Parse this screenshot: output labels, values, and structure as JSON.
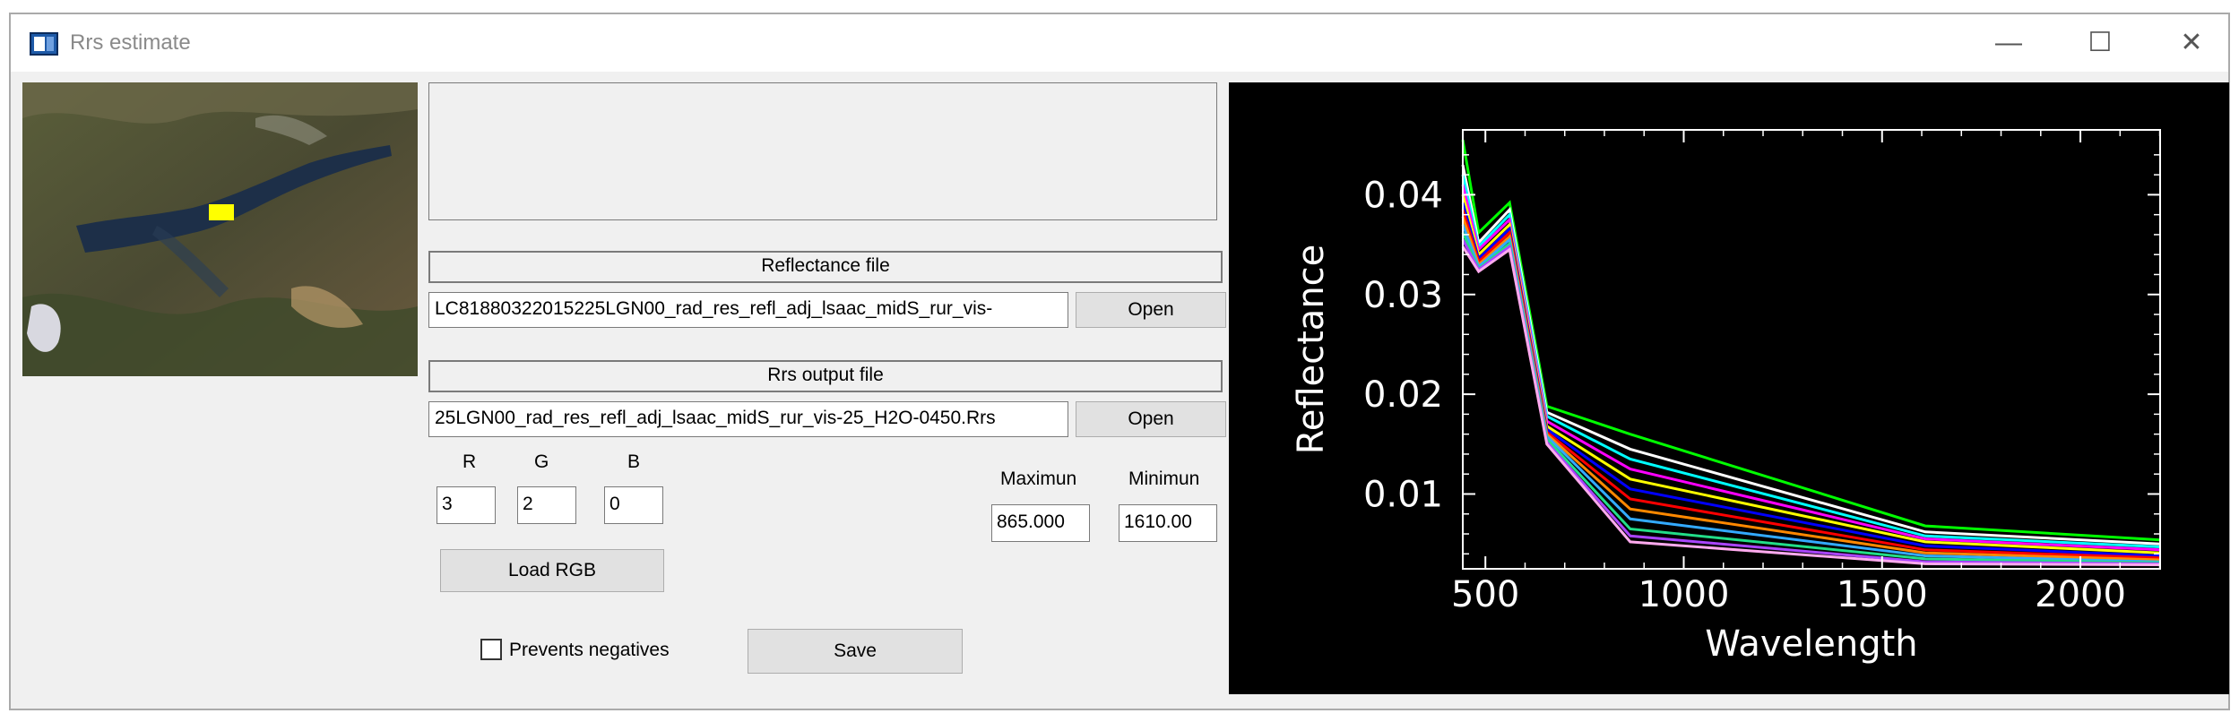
{
  "window": {
    "title": "Rrs estimate",
    "controls": {
      "minimize": "—",
      "maximize": "☐",
      "close": "✕"
    }
  },
  "reflectance": {
    "header": "Reflectance file",
    "path": "LC81880322015225LGN00_rad_res_refl_adj_lsaac_midS_rur_vis-",
    "open_label": "Open"
  },
  "rrs_output": {
    "header": "Rrs output file",
    "path": "25LGN00_rad_res_refl_adj_lsaac_midS_rur_vis-25_H2O-0450.Rrs",
    "open_label": "Open"
  },
  "rgb": {
    "r_label": "R",
    "g_label": "G",
    "b_label": "B",
    "r_value": "3",
    "g_value": "2",
    "b_value": "0",
    "load_label": "Load RGB"
  },
  "range": {
    "max_label": "Maximun",
    "min_label": "Minimun",
    "max_value": "865.000",
    "min_value": "1610.00"
  },
  "options": {
    "prevent_negatives_label": "Prevents negatives",
    "prevent_negatives_checked": false
  },
  "save_label": "Save",
  "chart_data": {
    "type": "line",
    "xlabel": "Wavelength",
    "ylabel": "Reflectance",
    "x": [
      443,
      483,
      561,
      655,
      865,
      1609,
      2201
    ],
    "xlim": [
      443,
      2201
    ],
    "ylim": [
      0.0025,
      0.0465
    ],
    "xticks": [
      500,
      1000,
      1500,
      2000
    ],
    "yticks": [
      0.01,
      0.02,
      0.03,
      0.04
    ],
    "ytick_labels": [
      "0.01",
      "0.02",
      "0.03",
      "0.04"
    ],
    "grid": false,
    "background": "#000000",
    "series_colors": [
      "#00ff00",
      "#ffffff",
      "#00ffff",
      "#ff00ff",
      "#ffff00",
      "#0000ff",
      "#ff0000",
      "#ff8800",
      "#33aaff",
      "#22dd88",
      "#aa44ff",
      "#ffaaee"
    ],
    "series": [
      {
        "values": [
          0.0455,
          0.0362,
          0.0392,
          0.0188,
          0.016,
          0.0068,
          0.0054
        ]
      },
      {
        "values": [
          0.043,
          0.0352,
          0.0385,
          0.0182,
          0.0145,
          0.0062,
          0.005
        ]
      },
      {
        "values": [
          0.042,
          0.0348,
          0.038,
          0.0178,
          0.0135,
          0.0058,
          0.0047
        ]
      },
      {
        "values": [
          0.041,
          0.0345,
          0.0375,
          0.0173,
          0.0125,
          0.0055,
          0.0044
        ]
      },
      {
        "values": [
          0.04,
          0.034,
          0.037,
          0.0168,
          0.0115,
          0.0052,
          0.0041
        ]
      },
      {
        "values": [
          0.0392,
          0.0336,
          0.0366,
          0.0165,
          0.0105,
          0.0048,
          0.0038
        ]
      },
      {
        "values": [
          0.0385,
          0.0333,
          0.0362,
          0.0162,
          0.0095,
          0.0044,
          0.0036
        ]
      },
      {
        "values": [
          0.0378,
          0.033,
          0.0358,
          0.016,
          0.0085,
          0.0041,
          0.0034
        ]
      },
      {
        "values": [
          0.037,
          0.0328,
          0.0355,
          0.0158,
          0.0075,
          0.0038,
          0.0032
        ]
      },
      {
        "values": [
          0.0362,
          0.0326,
          0.0351,
          0.0155,
          0.0065,
          0.0035,
          0.0031
        ]
      },
      {
        "values": [
          0.0355,
          0.0325,
          0.0348,
          0.0152,
          0.0058,
          0.0032,
          0.003
        ]
      },
      {
        "values": [
          0.0348,
          0.0323,
          0.0345,
          0.015,
          0.0052,
          0.003,
          0.0029
        ]
      }
    ]
  }
}
